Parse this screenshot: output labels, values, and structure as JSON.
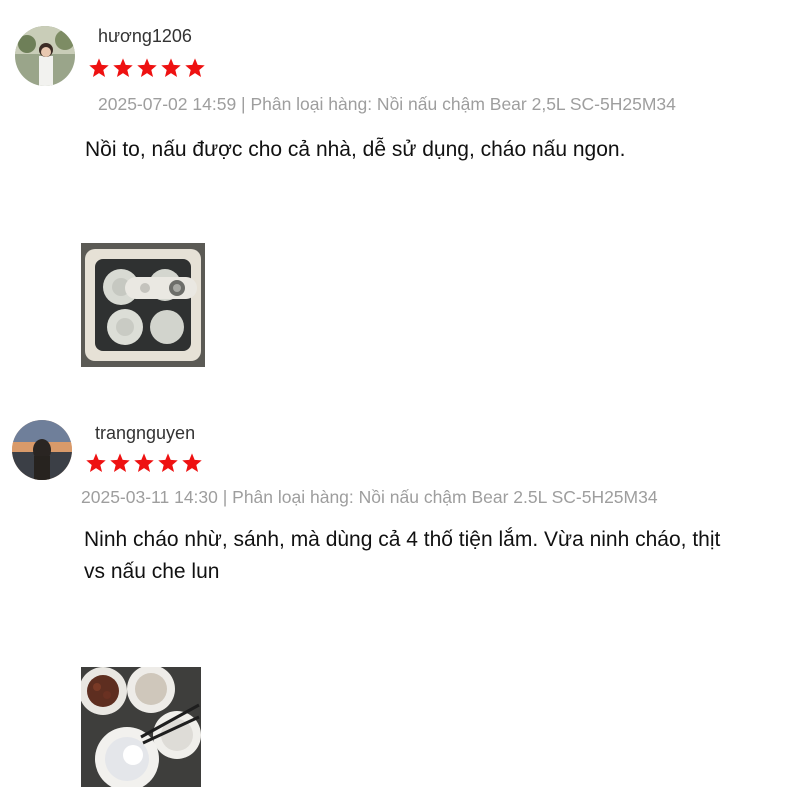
{
  "reviews": [
    {
      "username": "hương1206",
      "rating": 5,
      "meta": "2025-07-02 14:59 | Phân loại hàng: Nồi nấu chậm Bear 2,5L SC-5H25M34",
      "comment": "Nồi to, nấu được cho cả nhà, dễ sử dụng, cháo nấu ngon."
    },
    {
      "username": "trangnguyen",
      "rating": 5,
      "meta": "2025-03-11 14:30 | Phân loại hàng: Nồi nấu chậm Bear 2.5L SC-5H25M34",
      "comment": "Ninh cháo nhừ, sánh, mà dùng cả 4 thố tiện lắm. Vừa ninh cháo, thịt vs nấu che lun"
    }
  ],
  "colors": {
    "star": "#ee1111",
    "meta_text": "#9e9e9e",
    "username_text": "#333333"
  }
}
